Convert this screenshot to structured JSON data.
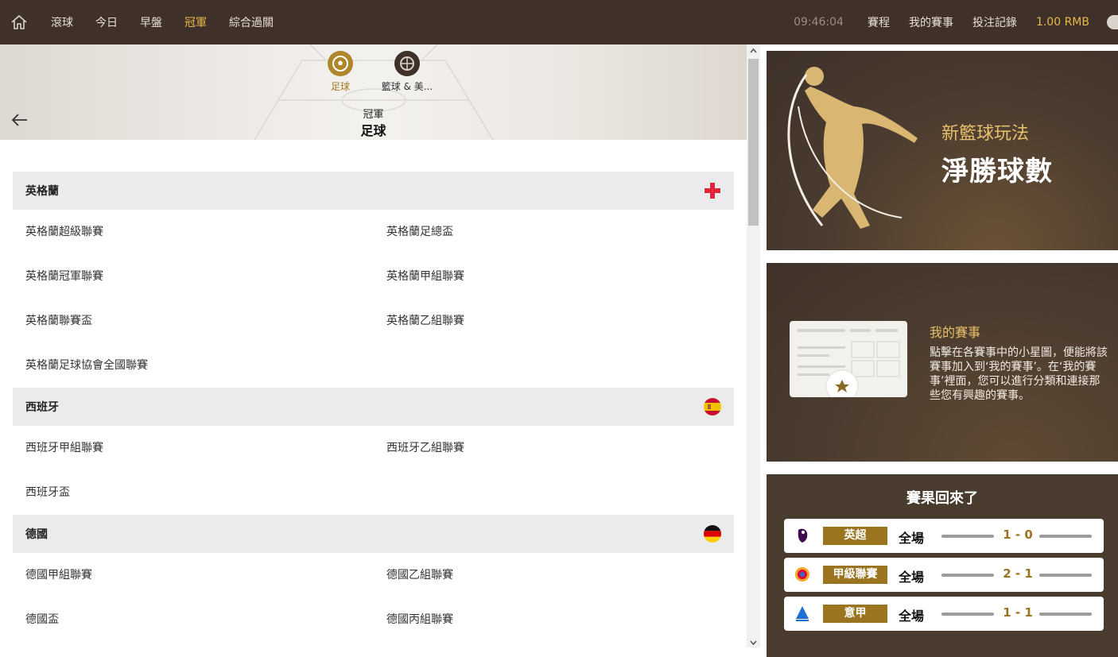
{
  "topbar": {
    "nav": [
      "滾球",
      "今日",
      "早盤",
      "冠軍",
      "綜合過關"
    ],
    "active": "冠軍",
    "clock": "09:46:04",
    "links": [
      "賽程",
      "我的賽事",
      "投注記錄"
    ],
    "balance": "1.00 RMB"
  },
  "hero": {
    "sports": [
      {
        "label": "足球",
        "icon": "soccer-ball-icon",
        "active": true
      },
      {
        "label": "籃球 & 美...",
        "icon": "basketball-icon",
        "active": false
      }
    ],
    "title_small": "冠軍",
    "title_big": "足球"
  },
  "groups": [
    {
      "name": "英格蘭",
      "flag": "england-flag-icon",
      "items": [
        "英格蘭超級聯賽",
        "英格蘭足總盃",
        "英格蘭冠軍聯賽",
        "英格蘭甲組聯賽",
        "英格蘭聯賽盃",
        "英格蘭乙組聯賽",
        "英格蘭足球協會全國聯賽"
      ]
    },
    {
      "name": "西班牙",
      "flag": "spain-flag-icon",
      "items": [
        "西班牙甲組聯賽",
        "西班牙乙組聯賽",
        "西班牙盃"
      ]
    },
    {
      "name": "德國",
      "flag": "germany-flag-icon",
      "items": [
        "德國甲組聯賽",
        "德國乙組聯賽",
        "德國盃",
        "德國丙組聯賽"
      ]
    }
  ],
  "banners": {
    "basketball": {
      "sub": "新籃球玩法",
      "main": "淨勝球數"
    },
    "my_events": {
      "title": "我的賽事",
      "desc": "點擊在各賽事中的小星圖，便能將該賽事加入到‘我的賽事’。在‘我的賽事’裡面，您可以進行分類和連接那些您有興趣的賽事。"
    },
    "results": {
      "title": "賽果回來了",
      "rows": [
        {
          "league": "英超",
          "period": "全場",
          "score": "1 - 0",
          "logo": "premier-league-logo-icon"
        },
        {
          "league": "甲級聯賽",
          "period": "全場",
          "score": "2 - 1",
          "logo": "laliga-logo-icon"
        },
        {
          "league": "意甲",
          "period": "全場",
          "score": "1 - 1",
          "logo": "serie-a-logo-icon"
        }
      ]
    }
  },
  "colors": {
    "topbar": "#3f3129",
    "accent": "#e8b94a",
    "gold": "#9b7420",
    "banner": "#4a3b2f"
  }
}
